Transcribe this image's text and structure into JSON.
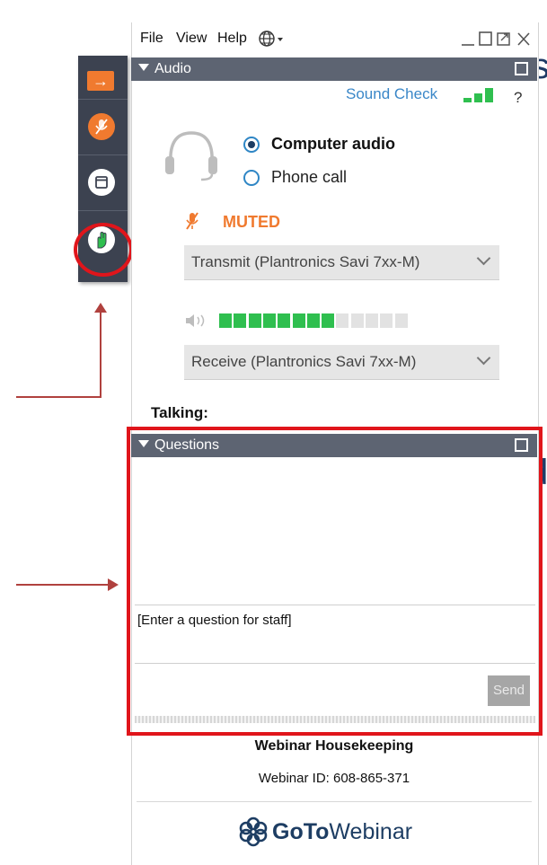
{
  "slide": {
    "fragment_top": "s",
    "fragment_mid": "d"
  },
  "menu": {
    "file": "File",
    "view": "View",
    "help": "Help"
  },
  "audio": {
    "header": "Audio",
    "sound_check": "Sound Check",
    "help_mark": "?",
    "option_computer": "Computer audio",
    "option_phone": "Phone call",
    "selected_option": "Computer audio",
    "muted_label": "MUTED",
    "transmit_device": "Transmit (Plantronics Savi 7xx-M)",
    "receive_device": "Receive (Plantronics Savi 7xx-M)",
    "speaker_level": {
      "filled": 8,
      "total": 13
    },
    "signal_bars": {
      "filled": 3,
      "total": 3
    }
  },
  "talking": {
    "label": "Talking:"
  },
  "questions": {
    "header": "Questions",
    "input_placeholder": "[Enter a question for staff]",
    "send_label": "Send"
  },
  "footer": {
    "title": "Webinar Housekeeping",
    "webinar_id": "Webinar ID: 608-865-371",
    "brand_bold": "GoTo",
    "brand_light": "Webinar"
  },
  "colors": {
    "accent_orange": "#f07a2f",
    "header_gray": "#5d6472",
    "toolbar_dark": "#3c4250",
    "meter_green": "#2fbf4f",
    "highlight_red": "#e0151b",
    "link_blue": "#3a87c8",
    "brand_navy": "#1d3d63"
  }
}
